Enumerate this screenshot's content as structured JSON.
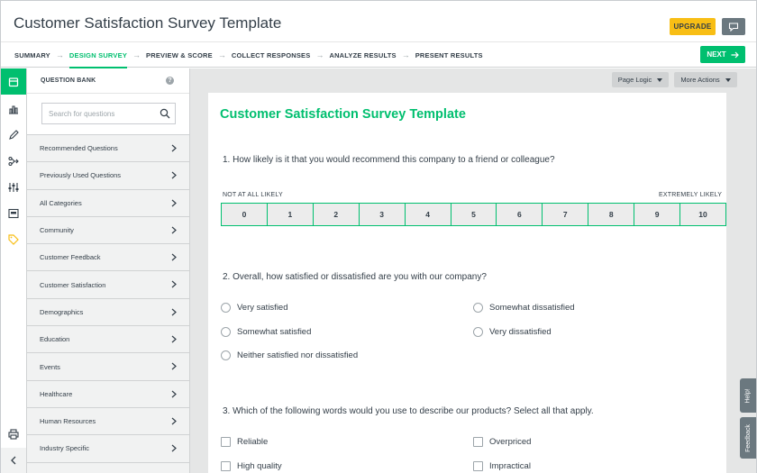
{
  "header": {
    "title": "Customer Satisfaction Survey Template",
    "upgrade_label": "UPGRADE"
  },
  "steps": [
    {
      "label": "SUMMARY",
      "active": false
    },
    {
      "label": "DESIGN SURVEY",
      "active": true
    },
    {
      "label": "PREVIEW & SCORE",
      "active": false
    },
    {
      "label": "COLLECT RESPONSES",
      "active": false
    },
    {
      "label": "ANALYZE RESULTS",
      "active": false
    },
    {
      "label": "PRESENT RESULTS",
      "active": false
    }
  ],
  "next_label": "NEXT",
  "rail": [
    "builder-icon",
    "analytics-icon",
    "design-pen-icon",
    "logic-icon",
    "options-sliders-icon",
    "library-image-icon",
    "tag-icon",
    "print-icon",
    "collapse-chevron-icon"
  ],
  "qbank": {
    "title": "QUESTION BANK",
    "help": "?",
    "search_placeholder": "Search for questions",
    "categories": [
      "Recommended Questions",
      "Previously Used Questions",
      "All Categories",
      "Community",
      "Customer Feedback",
      "Customer Satisfaction",
      "Demographics",
      "Education",
      "Events",
      "Healthcare",
      "Human Resources",
      "Industry Specific"
    ]
  },
  "toolbar": {
    "page_logic": "Page Logic",
    "more_actions": "More Actions"
  },
  "survey": {
    "title": "Customer Satisfaction Survey Template",
    "q1": {
      "text": "1. How likely is it that you would recommend this company to a friend or colleague?",
      "low_label": "NOT AT ALL LIKELY",
      "high_label": "EXTREMELY LIKELY",
      "scale": [
        "0",
        "1",
        "2",
        "3",
        "4",
        "5",
        "6",
        "7",
        "8",
        "9",
        "10"
      ]
    },
    "q2": {
      "text": "2. Overall, how satisfied or dissatisfied are you with our company?",
      "options": [
        "Very satisfied",
        "Somewhat dissatisfied",
        "Somewhat satisfied",
        "Very dissatisfied",
        "Neither satisfied nor dissatisfied"
      ]
    },
    "q3": {
      "text": "3. Which of the following words would you use to describe our products? Select all that apply.",
      "options": [
        "Reliable",
        "Overpriced",
        "High quality",
        "Impractical"
      ]
    }
  },
  "side_tabs": {
    "help": "Help!",
    "feedback": "Feedback"
  },
  "colors": {
    "accent": "#00bf6f",
    "upgrade": "#f8be15",
    "dark": "#333e48"
  }
}
